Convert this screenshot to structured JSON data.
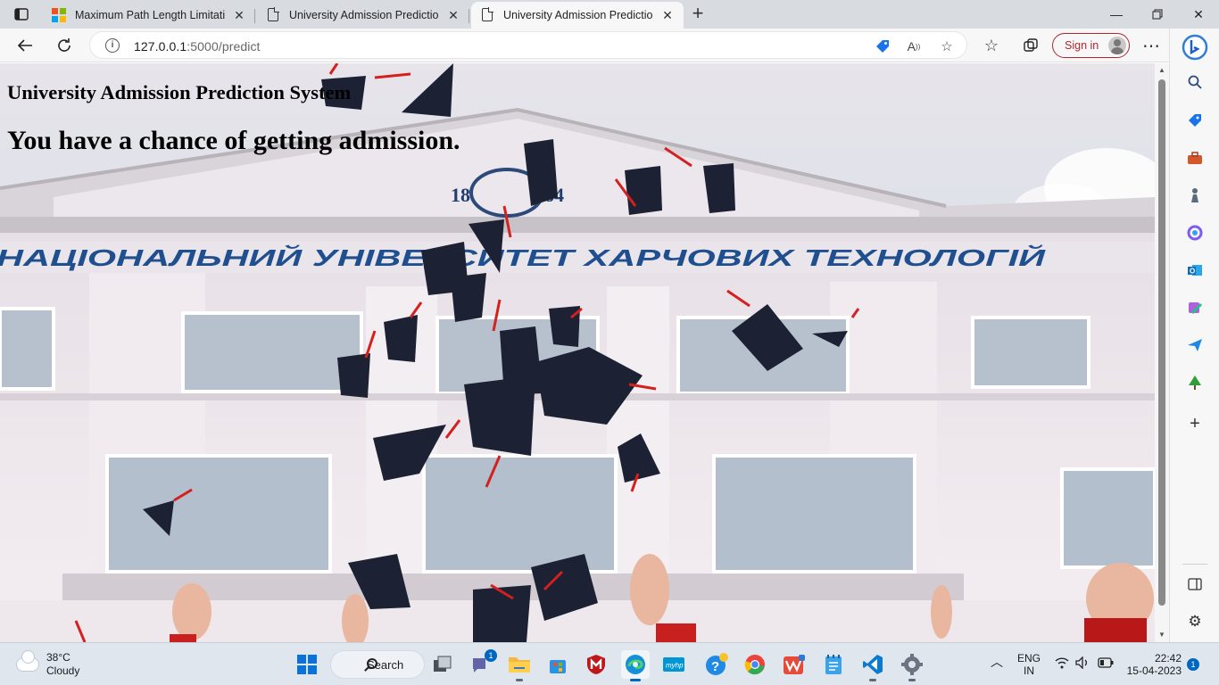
{
  "browser": {
    "tabs": [
      {
        "title": "Maximum Path Length Limitation",
        "active": false,
        "favicon": "microsoft-logo"
      },
      {
        "title": "University Admission Prediction S",
        "active": false,
        "favicon": "document-icon"
      },
      {
        "title": "University Admission Prediction S",
        "active": true,
        "favicon": "document-icon"
      }
    ],
    "address": {
      "host": "127.0.0.1",
      "rest": ":5000/predict"
    },
    "signin_label": "Sign in",
    "accent": "#b2272f"
  },
  "page": {
    "heading": "University Admission Prediction System",
    "result": "You have a chance of getting admission.",
    "banner_text": "НАЦІОНАЛЬНИЙ УНІВЕРСИТЕТ ХАРЧОВИХ ТЕХНОЛОГІЙ",
    "emblem_year_left": "18",
    "emblem_year_right": "84"
  },
  "taskbar": {
    "weather_temp": "38°C",
    "weather_desc": "Cloudy",
    "search_label": "Search",
    "lang_top": "ENG",
    "lang_bottom": "IN",
    "time": "22:42",
    "date": "15-04-2023",
    "notification_count": "1",
    "teams_badge": "1"
  }
}
